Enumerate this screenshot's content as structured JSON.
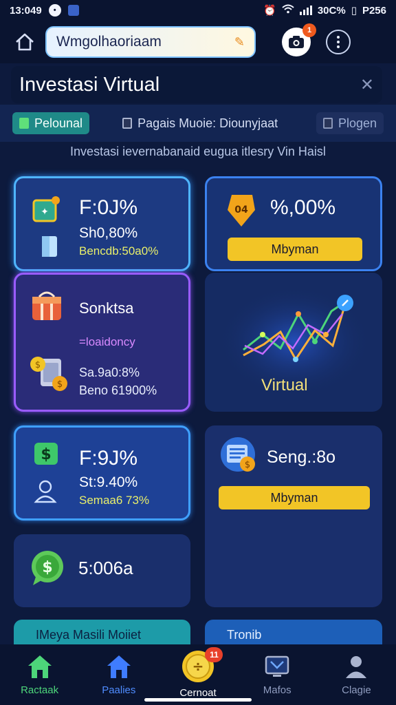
{
  "status_bar": {
    "time": "13:049",
    "battery_text": "30C%",
    "carrier": "P256"
  },
  "browser": {
    "url": "Wmgolhaoriaam",
    "camera_badge": "1"
  },
  "page": {
    "title": "Investasi Virtual",
    "subtitle": "Investasi ievernabanaid eugua itlesry Vin Haisl"
  },
  "tabs": [
    {
      "label": "Pelounal",
      "active": true
    },
    {
      "label": "Pagais Muoie: Diounyjaat",
      "active": false
    },
    {
      "label": "Plogen",
      "active": false
    }
  ],
  "cards": {
    "card1": {
      "value": "F:0J%",
      "line1": "Sh0,80%",
      "line2": "Bencdb:50a0%"
    },
    "card2": {
      "value": "%,00%",
      "button": "Mbyman",
      "icon_text": "04"
    },
    "card3": {
      "title": "Sonktsa",
      "tag": "=loaidoncy",
      "line1": "Sa.9a0:8%",
      "line2": "Beno 61900%"
    },
    "card4": {
      "label": "Virtual"
    },
    "card5": {
      "value": "F:9J%",
      "line1": "St:9.40%",
      "line2": "Semaa6 73%"
    },
    "card6": {
      "title": "Seng.:8o",
      "button": "Mbyman"
    },
    "card7": {
      "value": "5:006a"
    },
    "strip1": {
      "label": "IMeya Masili Moiiet"
    },
    "strip2": {
      "label": "Tronib"
    }
  },
  "nav": [
    {
      "label": "Ractaak",
      "icon": "home-icon"
    },
    {
      "label": "Paalies",
      "icon": "portfolio-icon"
    },
    {
      "label": "Cernoat",
      "icon": "coin-icon",
      "badge": "11"
    },
    {
      "label": "Mafos",
      "icon": "tv-icon"
    },
    {
      "label": "Clagie",
      "icon": "profile-icon"
    }
  ],
  "colors": {
    "background": "#0d1a3d",
    "accent_teal": "#1f8a88",
    "accent_yellow": "#f2c526",
    "accent_purple": "#9a5cff"
  }
}
